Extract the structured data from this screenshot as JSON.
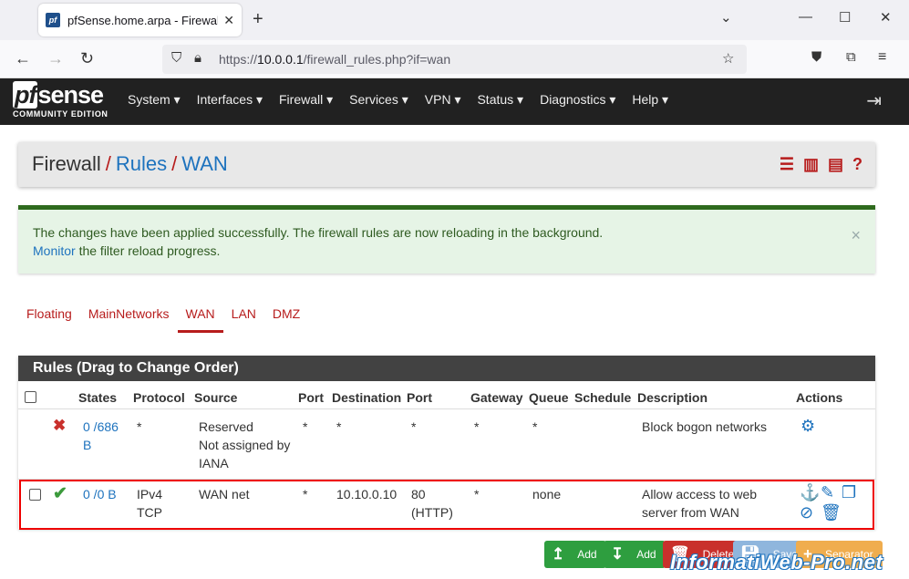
{
  "browser": {
    "tab_title": "pfSense.home.arpa - Firewall: R",
    "favicon_text": "pf",
    "url_scheme": "https://",
    "url_host": "10.0.0.1",
    "url_path": "/firewall_rules.php?if=wan"
  },
  "header": {
    "logo_text": "sense",
    "logo_pf": "pf",
    "logo_sub": "COMMUNITY EDITION",
    "menu": [
      "System ▾",
      "Interfaces ▾",
      "Firewall ▾",
      "Services ▾",
      "VPN ▾",
      "Status ▾",
      "Diagnostics ▾",
      "Help ▾"
    ]
  },
  "breadcrumb": {
    "part1": "Firewall",
    "part2": "Rules",
    "part3": "WAN",
    "sep": "/"
  },
  "alert": {
    "line1": "The changes have been applied successfully. The firewall rules are now reloading in the background.",
    "link": "Monitor",
    "line2_rest": " the filter reload progress.",
    "close": "×"
  },
  "interface_tabs": [
    "Floating",
    "MainNetworks",
    "WAN",
    "LAN",
    "DMZ"
  ],
  "active_tab": "WAN",
  "rules": {
    "title": "Rules (Drag to Change Order)",
    "columns": [
      "States",
      "Protocol",
      "Source",
      "Port",
      "Destination",
      "Port",
      "Gateway",
      "Queue",
      "Schedule",
      "Description",
      "Actions"
    ],
    "rows": [
      {
        "states_line1": "0 /686",
        "states_line2": "B",
        "protocol": "*",
        "source_l1": "Reserved",
        "source_l2": "Not assigned by",
        "source_l3": "IANA",
        "sport": "*",
        "destination": "*",
        "dport": "*",
        "gateway": "*",
        "queue": "*",
        "schedule": "",
        "description": "Block bogon networks"
      },
      {
        "states_line1": "0 /0 B",
        "protocol_l1": "IPv4",
        "protocol_l2": "TCP",
        "source": "WAN net",
        "sport": "*",
        "destination": "10.10.0.10",
        "dport_l1": "80",
        "dport_l2": "(HTTP)",
        "gateway": "*",
        "queue": "none",
        "schedule": "",
        "description_l1": "Allow access to web",
        "description_l2": "server from WAN"
      }
    ]
  },
  "buttons": {
    "add_top": "Add",
    "add_bottom": "Add",
    "delete": "Delete",
    "save": "Save",
    "separator": "Separator"
  },
  "watermark": "InformatiWeb-Pro.net",
  "colors": {
    "accent": "#b71c1c",
    "link": "#1e73be",
    "header_bg": "#212121",
    "success_bar": "#2e6a1d"
  }
}
